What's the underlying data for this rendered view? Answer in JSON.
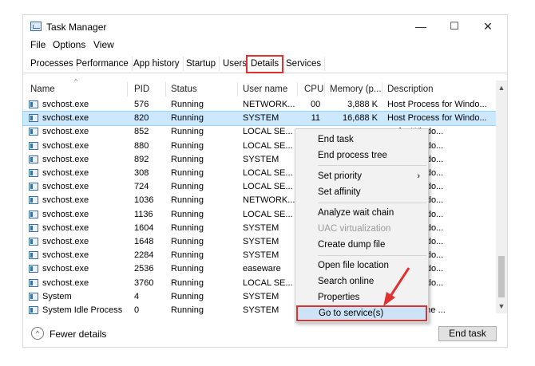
{
  "window": {
    "title": "Task Manager",
    "min": "—",
    "max": "☐",
    "close": "✕"
  },
  "menu": [
    "File",
    "Options",
    "View"
  ],
  "tabs": [
    "Processes",
    "Performance",
    "App history",
    "Startup",
    "Users",
    "Details",
    "Services"
  ],
  "active_tab": "Details",
  "columns": [
    "Name",
    "PID",
    "Status",
    "User name",
    "CPU",
    "Memory (p...",
    "Description"
  ],
  "rows": [
    {
      "name": "svchost.exe",
      "pid": "576",
      "status": "Running",
      "user": "NETWORK...",
      "cpu": "00",
      "mem": "3,888 K",
      "desc": "Host Process for Windo..."
    },
    {
      "name": "svchost.exe",
      "pid": "820",
      "status": "Running",
      "user": "SYSTEM",
      "cpu": "11",
      "mem": "16,688 K",
      "desc": "Host Process for Windo..."
    },
    {
      "name": "svchost.exe",
      "pid": "852",
      "status": "Running",
      "user": "LOCAL SE...",
      "cpu": "",
      "mem": "",
      "desc": "ss for Windo..."
    },
    {
      "name": "svchost.exe",
      "pid": "880",
      "status": "Running",
      "user": "LOCAL SE...",
      "cpu": "",
      "mem": "",
      "desc": "ss for Windo..."
    },
    {
      "name": "svchost.exe",
      "pid": "892",
      "status": "Running",
      "user": "SYSTEM",
      "cpu": "",
      "mem": "",
      "desc": "ss for Windo..."
    },
    {
      "name": "svchost.exe",
      "pid": "308",
      "status": "Running",
      "user": "LOCAL SE...",
      "cpu": "",
      "mem": "",
      "desc": "ss for Windo..."
    },
    {
      "name": "svchost.exe",
      "pid": "724",
      "status": "Running",
      "user": "LOCAL SE...",
      "cpu": "",
      "mem": "",
      "desc": "ss for Windo..."
    },
    {
      "name": "svchost.exe",
      "pid": "1036",
      "status": "Running",
      "user": "NETWORK...",
      "cpu": "",
      "mem": "",
      "desc": "ss for Windo..."
    },
    {
      "name": "svchost.exe",
      "pid": "1136",
      "status": "Running",
      "user": "LOCAL SE...",
      "cpu": "",
      "mem": "",
      "desc": "ss for Windo..."
    },
    {
      "name": "svchost.exe",
      "pid": "1604",
      "status": "Running",
      "user": "SYSTEM",
      "cpu": "",
      "mem": "",
      "desc": "ss for Windo..."
    },
    {
      "name": "svchost.exe",
      "pid": "1648",
      "status": "Running",
      "user": "SYSTEM",
      "cpu": "",
      "mem": "",
      "desc": "ss for Windo..."
    },
    {
      "name": "svchost.exe",
      "pid": "2284",
      "status": "Running",
      "user": "SYSTEM",
      "cpu": "",
      "mem": "",
      "desc": "ss for Windo..."
    },
    {
      "name": "svchost.exe",
      "pid": "2536",
      "status": "Running",
      "user": "easeware",
      "cpu": "",
      "mem": "",
      "desc": "ss for Windo..."
    },
    {
      "name": "svchost.exe",
      "pid": "3760",
      "status": "Running",
      "user": "LOCAL SE...",
      "cpu": "",
      "mem": "",
      "desc": "ss for Windo..."
    },
    {
      "name": "System",
      "pid": "4",
      "status": "Running",
      "user": "SYSTEM",
      "cpu": "",
      "mem": "",
      "desc": "& System"
    },
    {
      "name": "System Idle Process",
      "pid": "0",
      "status": "Running",
      "user": "SYSTEM",
      "cpu": "",
      "mem": "",
      "desc": "e of time the ..."
    }
  ],
  "context_menu": [
    "End task",
    "End process tree",
    "Set priority",
    "Set affinity",
    "Analyze wait chain",
    "UAC virtualization",
    "Create dump file",
    "Open file location",
    "Search online",
    "Properties",
    "Go to service(s)"
  ],
  "footer": {
    "fewer_details": "Fewer details",
    "end_task": "End task"
  },
  "colors": {
    "highlight_red": "#e0302f",
    "selection": "#cce8ff"
  }
}
